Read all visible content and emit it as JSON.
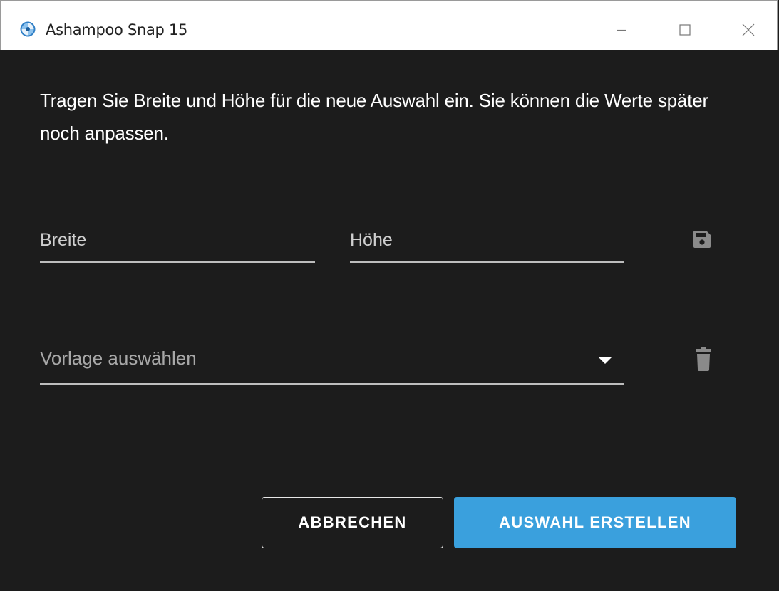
{
  "window": {
    "title": "Ashampoo Snap 15",
    "controls": [
      "minimize",
      "maximize",
      "close"
    ]
  },
  "dialog": {
    "prompt": "Tragen Sie Breite und Höhe für die neue Auswahl ein. Sie können die Werte später noch anpassen.",
    "width_field": {
      "placeholder": "Breite",
      "value": ""
    },
    "height_field": {
      "placeholder": "Höhe",
      "value": ""
    },
    "save_icon": "save-icon",
    "template_select": {
      "placeholder": "Vorlage auswählen",
      "value": ""
    },
    "delete_icon": "trash-icon",
    "cancel_label": "ABBRECHEN",
    "create_label": "AUSWAHL ERSTELLEN"
  },
  "colors": {
    "background": "#1c1c1c",
    "accent": "#3aa0dd",
    "titlebar": "#ffffff"
  }
}
